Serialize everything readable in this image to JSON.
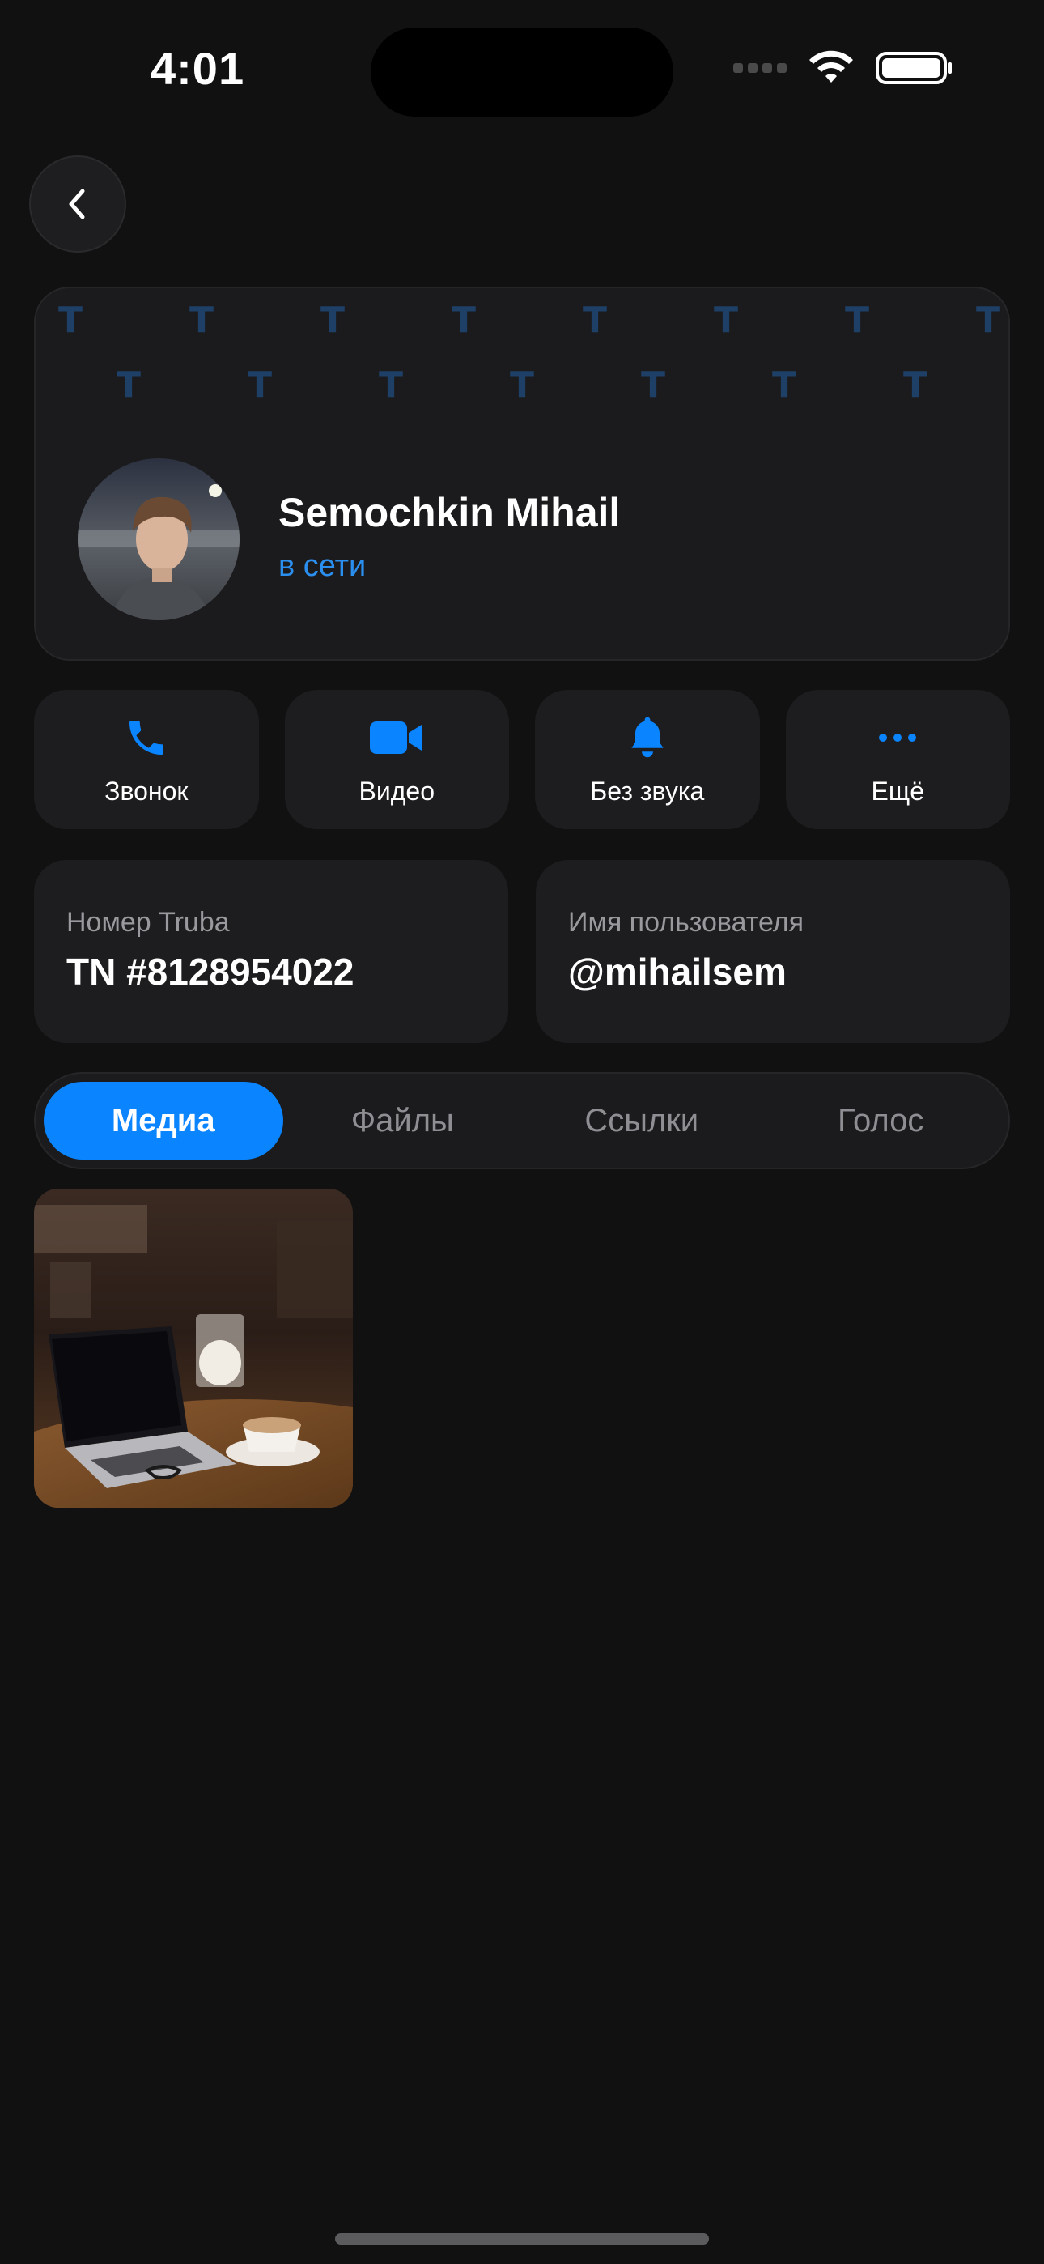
{
  "status_bar": {
    "time": "4:01"
  },
  "navigation": {
    "back_icon": "chevron-left-icon"
  },
  "profile": {
    "name": "Semochkin Mihail",
    "status": "в сети",
    "pattern_letter": "T",
    "accent_color": "#2b8ff0"
  },
  "actions": [
    {
      "label": "Звонок",
      "icon": "phone-icon"
    },
    {
      "label": "Видео",
      "icon": "video-camera-icon"
    },
    {
      "label": "Без звука",
      "icon": "bell-icon"
    },
    {
      "label": "Ещё",
      "icon": "more-dots-icon"
    }
  ],
  "info": {
    "number_label": "Номер Truba",
    "number_value": "TN #8128954022",
    "username_label": "Имя пользователя",
    "username_value": "@mihailsem"
  },
  "tabs": [
    {
      "label": "Медиа",
      "active": true
    },
    {
      "label": "Файлы",
      "active": false
    },
    {
      "label": "Ссылки",
      "active": false
    },
    {
      "label": "Голос",
      "active": false
    }
  ],
  "colors": {
    "background": "#111111",
    "card": "#1d1d1f",
    "accent": "#0a84ff",
    "muted_text": "#9a9a9e"
  }
}
